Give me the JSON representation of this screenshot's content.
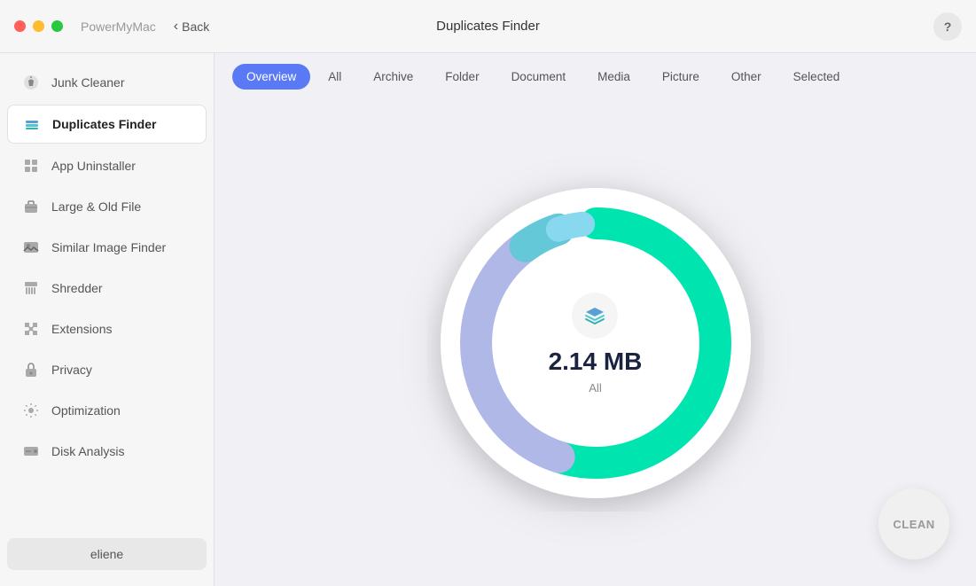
{
  "titlebar": {
    "app_name": "PowerMyMac",
    "back_label": "Back",
    "center_title": "Duplicates Finder",
    "help_label": "?"
  },
  "sidebar": {
    "items": [
      {
        "id": "junk-cleaner",
        "label": "Junk Cleaner",
        "icon": "broom"
      },
      {
        "id": "duplicates-finder",
        "label": "Duplicates Finder",
        "icon": "layers",
        "active": true
      },
      {
        "id": "app-uninstaller",
        "label": "App Uninstaller",
        "icon": "grid"
      },
      {
        "id": "large-old-file",
        "label": "Large & Old File",
        "icon": "briefcase"
      },
      {
        "id": "similar-image-finder",
        "label": "Similar Image Finder",
        "icon": "image"
      },
      {
        "id": "shredder",
        "label": "Shredder",
        "icon": "layers2"
      },
      {
        "id": "extensions",
        "label": "Extensions",
        "icon": "puzzle"
      },
      {
        "id": "privacy",
        "label": "Privacy",
        "icon": "lock"
      },
      {
        "id": "optimization",
        "label": "Optimization",
        "icon": "settings"
      },
      {
        "id": "disk-analysis",
        "label": "Disk Analysis",
        "icon": "hdd"
      }
    ],
    "user": "eliene"
  },
  "tabs": [
    {
      "id": "overview",
      "label": "Overview",
      "active": true
    },
    {
      "id": "all",
      "label": "All"
    },
    {
      "id": "archive",
      "label": "Archive"
    },
    {
      "id": "folder",
      "label": "Folder"
    },
    {
      "id": "document",
      "label": "Document"
    },
    {
      "id": "media",
      "label": "Media"
    },
    {
      "id": "picture",
      "label": "Picture"
    },
    {
      "id": "other",
      "label": "Other"
    },
    {
      "id": "selected",
      "label": "Selected"
    }
  ],
  "chart": {
    "size_label": "2.14 MB",
    "category_label": "All"
  },
  "clean_button": {
    "label": "CLEAN"
  },
  "donut": {
    "segments": [
      {
        "color": "#00e5b0",
        "pct": 0.55
      },
      {
        "color": "#b0b8e8",
        "pct": 0.35
      },
      {
        "color": "#64c8d8",
        "pct": 0.05
      },
      {
        "color": "#88d8f0",
        "pct": 0.05
      }
    ]
  }
}
